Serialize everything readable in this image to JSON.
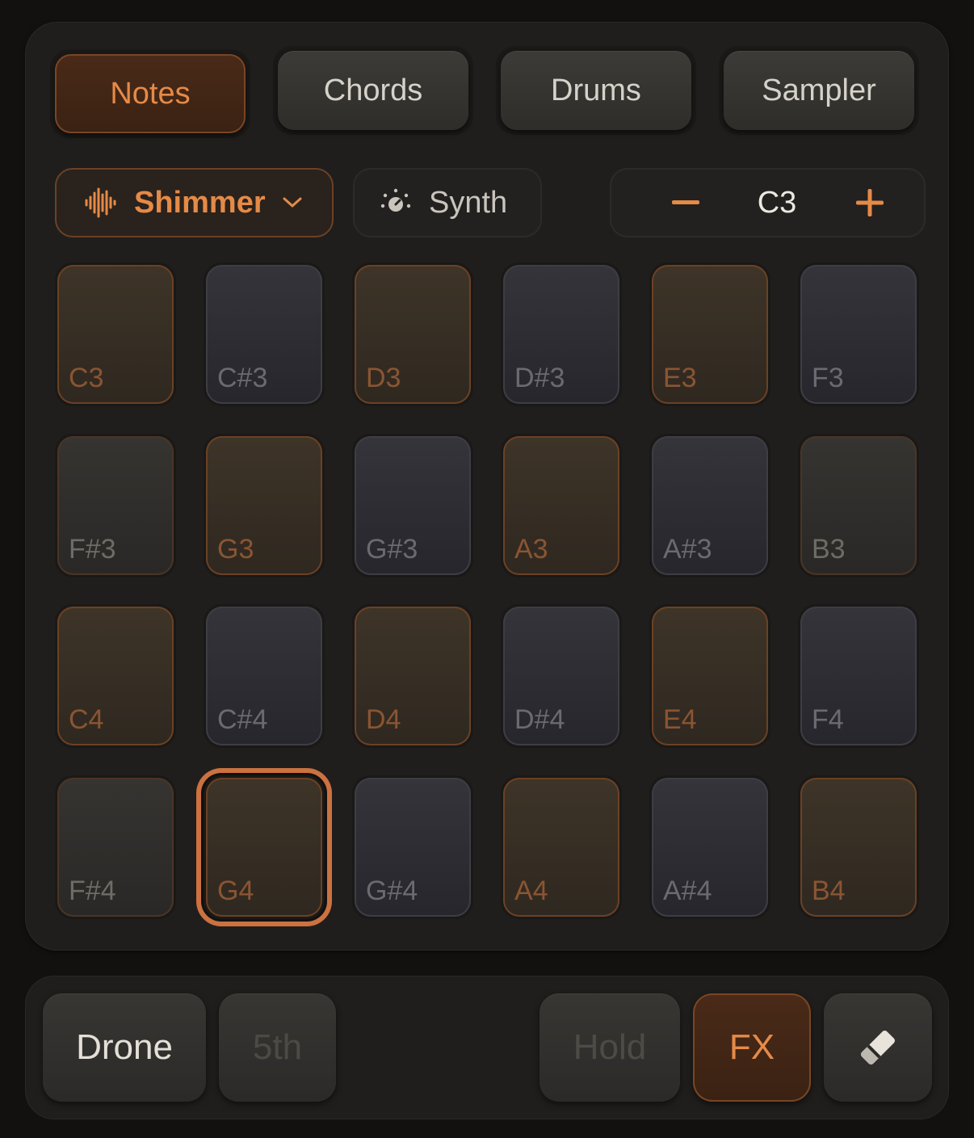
{
  "tabs": [
    {
      "label": "Notes",
      "active": true
    },
    {
      "label": "Chords",
      "active": false
    },
    {
      "label": "Drums",
      "active": false
    },
    {
      "label": "Sampler",
      "active": false
    }
  ],
  "controls": {
    "instrument": "Shimmer",
    "instrument_icon": "waveform-icon",
    "synth_label": "Synth",
    "synth_icon": "synth-knob-icon",
    "octave_value": "C3",
    "octave_minus": "−",
    "octave_plus": "+"
  },
  "pads": [
    [
      "C3",
      "C#3",
      "D3",
      "D#3",
      "E3",
      "F3"
    ],
    [
      "F#3",
      "G3",
      "G#3",
      "A3",
      "A#3",
      "B3"
    ],
    [
      "C4",
      "C#4",
      "D4",
      "D#4",
      "E4",
      "F4"
    ],
    [
      "F#4",
      "G4",
      "G#4",
      "A4",
      "A#4",
      "B4"
    ]
  ],
  "selected_pad": "G4",
  "bottom_bar": {
    "drone": "Drone",
    "fifth": "5th",
    "hold": "Hold",
    "fx": "FX",
    "eraser_icon": "eraser-icon"
  },
  "colors": {
    "accent": "#e58a47",
    "background": "#121110",
    "panel": "#1f1e1c"
  }
}
